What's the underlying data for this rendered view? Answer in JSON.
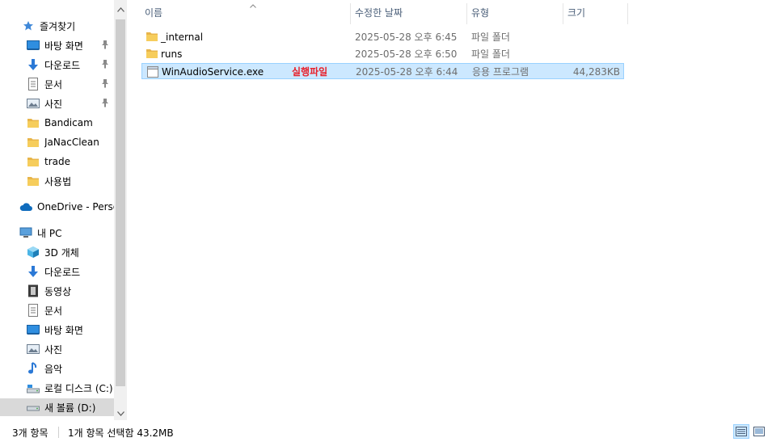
{
  "nav": {
    "quick_access": "즐겨찾기",
    "quick_items": [
      {
        "label": "바탕 화면",
        "icon": "desktop-icon",
        "pinned": true
      },
      {
        "label": "다운로드",
        "icon": "download-icon",
        "pinned": true
      },
      {
        "label": "문서",
        "icon": "document-icon",
        "pinned": true
      },
      {
        "label": "사진",
        "icon": "pictures-icon",
        "pinned": true
      },
      {
        "label": "Bandicam",
        "icon": "folder-icon",
        "pinned": false
      },
      {
        "label": "JaNacClean",
        "icon": "folder-icon",
        "pinned": false
      },
      {
        "label": "trade",
        "icon": "folder-icon",
        "pinned": false
      },
      {
        "label": "사용법",
        "icon": "folder-icon",
        "pinned": false
      }
    ],
    "onedrive": "OneDrive - Personal",
    "this_pc": "내 PC",
    "pc_items": [
      {
        "label": "3D 개체",
        "icon": "3d-objects-icon"
      },
      {
        "label": "다운로드",
        "icon": "download-icon"
      },
      {
        "label": "동영상",
        "icon": "video-icon"
      },
      {
        "label": "문서",
        "icon": "document-icon"
      },
      {
        "label": "바탕 화면",
        "icon": "desktop-icon"
      },
      {
        "label": "사진",
        "icon": "pictures-icon"
      },
      {
        "label": "음악",
        "icon": "music-icon"
      },
      {
        "label": "로컬 디스크 (C:)",
        "icon": "local-disk-icon"
      },
      {
        "label": "새 볼륨 (D:)",
        "icon": "drive-icon"
      }
    ]
  },
  "columns": {
    "name": "이름",
    "date": "수정한 날짜",
    "type": "유형",
    "size": "크기"
  },
  "files": [
    {
      "name": "_internal",
      "date": "2025-05-28 오후 6:45",
      "type": "파일 폴더",
      "size": "",
      "icon": "folder-icon",
      "selected": false
    },
    {
      "name": "runs",
      "date": "2025-05-28 오후 6:50",
      "type": "파일 폴더",
      "size": "",
      "icon": "folder-icon",
      "selected": false
    },
    {
      "name": "WinAudioService.exe",
      "date": "2025-05-28 오후 6:44",
      "type": "응용 프로그램",
      "size": "44,283KB",
      "icon": "application-icon",
      "selected": true,
      "annotation": "실행파일"
    }
  ],
  "status": {
    "item_count": "3개 항목",
    "selection": "1개 항목 선택함 43.2MB"
  },
  "colors": {
    "selection": "#cce8ff",
    "selection_border": "#99d1ff",
    "annotation": "#e8202a",
    "header_text": "#4c607a"
  }
}
